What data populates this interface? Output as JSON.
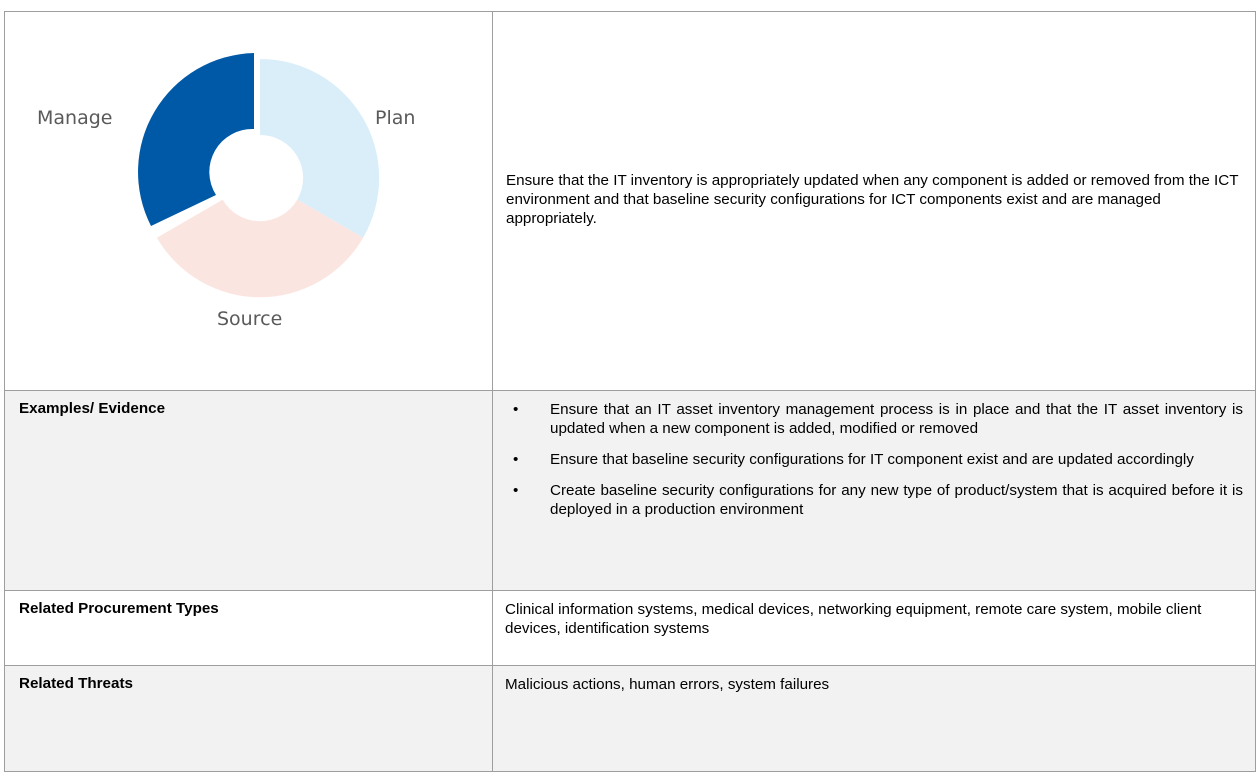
{
  "diagram": {
    "segments": [
      {
        "label": "Plan",
        "color": "#daeefa",
        "active": false
      },
      {
        "label": "Source",
        "color": "#fbe5e1",
        "active": false
      },
      {
        "label": "Manage",
        "color": "#0059a6",
        "active": true
      }
    ]
  },
  "description": "Ensure that the IT inventory is appropriately updated when any component is added or removed from the ICT environment and that baseline security configurations for ICT components exist and are managed appropriately.",
  "examples": {
    "label": "Examples/ Evidence",
    "items": [
      "Ensure that an IT asset inventory management process is in place and that the IT asset inventory is updated when a new component is added, modified or removed",
      "Ensure that baseline security configurations for IT component exist and are updated accordingly",
      "Create baseline security configurations for any new type of product/system that is acquired before it is deployed in a production environment"
    ]
  },
  "procurement": {
    "label": "Related Procurement Types",
    "value": "Clinical information systems, medical devices, networking equipment, remote care system, mobile client devices, identification systems"
  },
  "threats": {
    "label": "Related Threats",
    "value": "Malicious actions, human errors, system failures"
  }
}
